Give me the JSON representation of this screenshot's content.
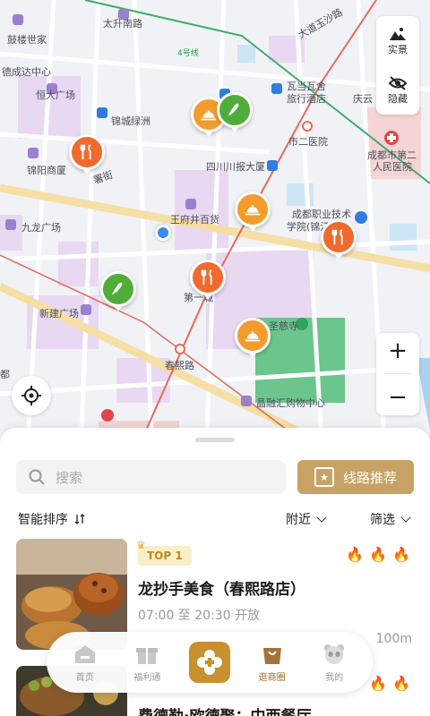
{
  "map": {
    "labels": [
      "鼓楼世家",
      "太升南路",
      "大道玉沙路",
      "德成达中心",
      "4号线",
      "瓦当瓦舍",
      "旅行酒店",
      "庆云",
      "恒大广场",
      "锦城绿洲",
      "市二医院",
      "成都市第二",
      "人民医院",
      "锦阳商厦",
      "署街",
      "四川川报大厦",
      "王府井百货",
      "成都职业技术",
      "学院(锦江校",
      "九龙广场",
      "第一城",
      "新建广场",
      "圣慈寺",
      "春熙路",
      "晶融汇购物中心",
      "都"
    ],
    "controls": {
      "realview_label": "实景",
      "hide_label": "隐藏",
      "zoom_in": "+",
      "zoom_out": "−"
    }
  },
  "search": {
    "placeholder": "搜索"
  },
  "route_button": {
    "label": "线路推荐"
  },
  "filters": {
    "sort": "智能排序",
    "nearby": "附近",
    "filter": "筛选"
  },
  "cards": [
    {
      "badge": "TOP 1",
      "title": "龙抄手美食（春熙路店）",
      "hours": "07:00 至 20:30 开放",
      "distance": "100m"
    },
    {
      "title": "费德勒·欧德聚：中西餐厅"
    }
  ],
  "tabbar": {
    "home": "首页",
    "welfare": "福利通",
    "shop": "逛商圈",
    "mine": "我的"
  },
  "colors": {
    "accent": "#c7a264",
    "pin_orange": "#f39c2d",
    "pin_red": "#f06a2e",
    "pin_green": "#4fae3a",
    "route_green": "#3fae6b",
    "route_red": "#e66a5a"
  }
}
